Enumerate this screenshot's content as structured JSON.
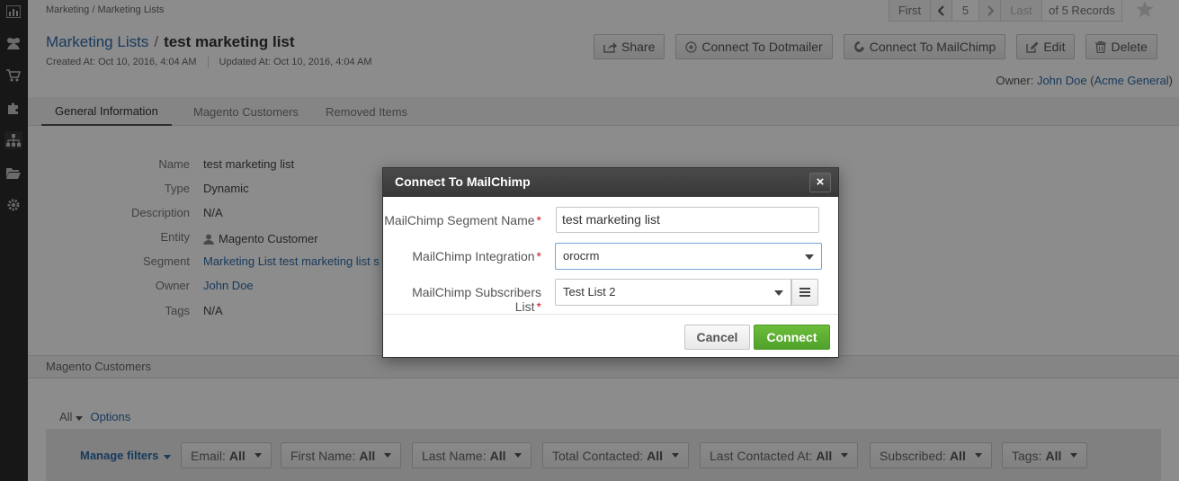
{
  "breadcrumb": "Marketing / Marketing Lists",
  "pager": {
    "first": "First",
    "current": "5",
    "last": "Last",
    "total": "of 5 Records"
  },
  "title": {
    "entity": "Marketing Lists",
    "separator": "/",
    "record": "test marketing list"
  },
  "meta": {
    "created": "Created At: Oct 10, 2016, 4:04 AM",
    "updated": "Updated At: Oct 10, 2016, 4:04 AM"
  },
  "actions": {
    "share": "Share",
    "dotmailer": "Connect To Dotmailer",
    "mailchimp": "Connect To MailChimp",
    "edit": "Edit",
    "delete": "Delete"
  },
  "owner": {
    "label": "Owner:",
    "name": "John Doe",
    "org": "Acme General"
  },
  "tabs": [
    "General Information",
    "Magento Customers",
    "Removed Items"
  ],
  "fields": [
    {
      "label": "Name",
      "value": "test marketing list"
    },
    {
      "label": "Type",
      "value": "Dynamic"
    },
    {
      "label": "Description",
      "value": "N/A"
    },
    {
      "label": "Entity",
      "value": "Magento Customer"
    },
    {
      "label": "Segment",
      "value": "Marketing List test marketing list s"
    },
    {
      "label": "Owner",
      "value": "John Doe"
    },
    {
      "label": "Tags",
      "value": "N/A"
    }
  ],
  "section_title": "Magento Customers",
  "grid": {
    "view": "All",
    "options": "Options",
    "manage_filters": "Manage filters",
    "filters": [
      {
        "name": "Email:",
        "value": "All"
      },
      {
        "name": "First Name:",
        "value": "All"
      },
      {
        "name": "Last Name:",
        "value": "All"
      },
      {
        "name": "Total Contacted:",
        "value": "All"
      },
      {
        "name": "Last Contacted At:",
        "value": "All"
      },
      {
        "name": "Subscribed:",
        "value": "All"
      },
      {
        "name": "Tags:",
        "value": "All"
      }
    ]
  },
  "modal": {
    "title": "Connect To MailChimp",
    "close": "×",
    "segment_label": "MailChimp Segment Name",
    "segment_value": "test marketing list",
    "integration_label": "MailChimp Integration",
    "integration_value": "orocrm",
    "list_label": "MailChimp Subscribers List",
    "list_value": "Test List 2",
    "required_mark": "*",
    "cancel": "Cancel",
    "connect": "Connect"
  },
  "colors": {
    "accent": "#2e6aa8",
    "connect": "#5aad30",
    "required": "#c81d1d"
  }
}
